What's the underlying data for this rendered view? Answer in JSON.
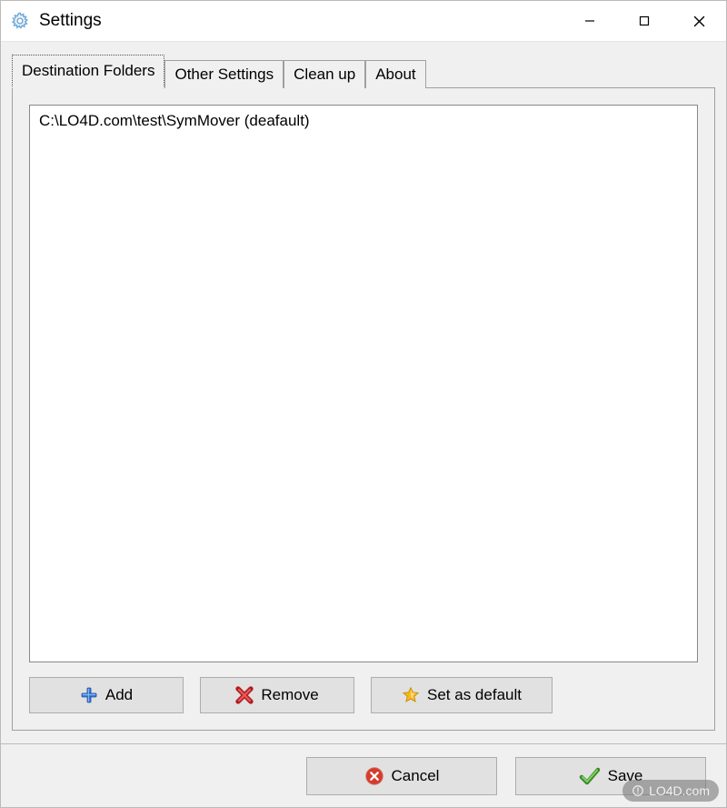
{
  "window": {
    "title": "Settings"
  },
  "tabs": [
    {
      "label": "Destination Folders",
      "active": true
    },
    {
      "label": "Other Settings",
      "active": false
    },
    {
      "label": "Clean up",
      "active": false
    },
    {
      "label": "About",
      "active": false
    }
  ],
  "folders": {
    "items": [
      "C:\\LO4D.com\\test\\SymMover (deafault)"
    ]
  },
  "buttons": {
    "add": "Add",
    "remove": "Remove",
    "set_default": "Set as default",
    "cancel": "Cancel",
    "save": "Save"
  },
  "watermark": "LO4D.com"
}
